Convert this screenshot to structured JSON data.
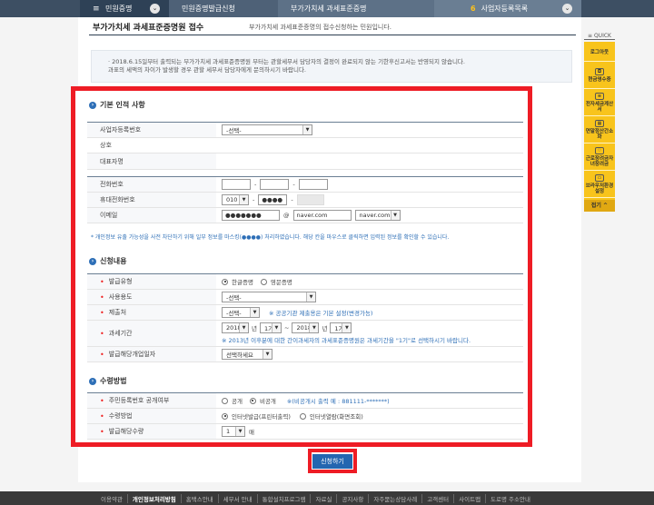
{
  "nav": {
    "home": "민원증명",
    "step1": "민원증명발급신청",
    "step2": "부가가치세 과세표준증명",
    "step3_num": "6",
    "step3": "사업자등록목록"
  },
  "page": {
    "title": "부가가치세 과세표준증명원 접수",
    "subtitle": "부가가치세 과세표준증명의 접수신청하는 민원입니다.",
    "notice_line1": "· 2018.6.15일부터 출력되는 부가가치세 과세표준증명원 부터는 관할세무서 담당자의 결정이 완료되지 않는 기한후신고서는 반영되지 않습니다.",
    "notice_line2": "과표의 세액의 차이가 발생할 경우 관할 세무서 담당자에게 문의하시기 바랍니다."
  },
  "basic": {
    "heading": "기본 인적 사항",
    "biz_no_label": "사업자등록번호",
    "biz_no_value": "-선택-",
    "name_label": "상호",
    "rep_label": "대표자명",
    "phone_label": "전화번호",
    "mobile_label": "휴대전화번호",
    "mobile_prefix": "010",
    "mobile_mid": "●●●●",
    "email_label": "이메일",
    "email_local": "●●●●●●●",
    "email_domain": "naver.com",
    "email_domain_select": "naver.com",
    "hint": "* 개인정보 유출 가능성을 사전 차단하기 위해 일부 정보를 마스킹(●●●●) 처리하였습니다. 해당 칸을 마우스로 클릭하면 입력된 정보를 확인할 수 있습니다."
  },
  "apply": {
    "heading": "신청내용",
    "type_label": "발급유형",
    "type_kr": "한글증명",
    "type_en": "영문증명",
    "purpose_label": "사용용도",
    "purpose_value": "-선택-",
    "submit_to_label": "제출처",
    "submit_to_value": "-선택-",
    "submit_note": "※ 공공기관 제출용은 기본 설정(변경가능)",
    "period_label": "과세기간",
    "from_year": "2018",
    "year_unit": "년",
    "from_term": "1기",
    "tilde": "~",
    "to_year": "2018",
    "to_term": "1기",
    "period_note": "※ 2013년 이후분에 대한 간이과세자의 과세표준증명원은 과세기간을 \"1기\"로 선택하시기 바랍니다.",
    "biz_place_label": "발급해당개업일자",
    "biz_place_value": "선택하세요"
  },
  "receive": {
    "heading": "수령방법",
    "rrn_label": "주민등록번호 공개여부",
    "rrn_open": "공개",
    "rrn_closed": "비공개",
    "rrn_note": "※(비공개시 출력 예 : 881111-*******)",
    "method_label": "수령방법",
    "method_print": "인터넷발급(프린터출력)",
    "method_view": "인터넷열람(화면조회)",
    "copies_label": "발급해당수량",
    "copies_value": "1",
    "copies_unit": "매"
  },
  "submit_label": "신청하기",
  "quick": {
    "head": "≡ QUICK",
    "logout": "로그아웃",
    "cash_receipt": "현금영수증",
    "e_tax": "전자세금계산서",
    "year_end": "연말정산간소화",
    "eitc": "근로장려금자녀장려금",
    "browser": "브라우저환경설정",
    "close": "접기 ^"
  },
  "footer": [
    "이용약관",
    "개인정보처리방침",
    "홈택스안내",
    "세무서 안내",
    "통합설치프로그램",
    "자료실",
    "공지사항",
    "자주묻는상담사례",
    "고객센터",
    "사이트맵",
    "도로명 주소안내"
  ]
}
